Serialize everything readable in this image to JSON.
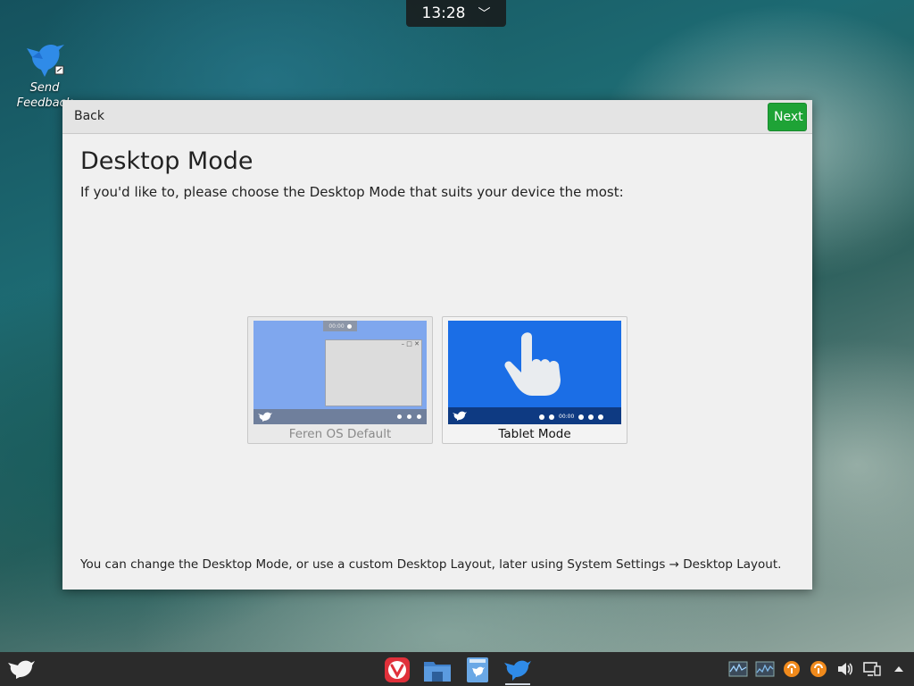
{
  "top_panel": {
    "clock": "13:28",
    "expand_glyph": "﹀"
  },
  "desktop_icons": [
    {
      "label": "Send Feedback",
      "icon": "feedback-bird-icon"
    }
  ],
  "dialog": {
    "back_label": "Back",
    "next_label": "Next",
    "title": "Desktop Mode",
    "subtitle": "If you'd like to, please choose the Desktop Mode that suits your device the most:",
    "footer": "You can change the Desktop Mode, or use a custom Desktop Layout, later using System Settings → Desktop Layout.",
    "modes": [
      {
        "label": "Feren OS Default",
        "preview_clock": "00:00",
        "selected": false
      },
      {
        "label": "Tablet Mode",
        "preview_clock": "00:00",
        "selected": true
      }
    ]
  },
  "taskbar": {
    "start_icon": "feren-bird-icon",
    "apps": [
      {
        "name": "Vivaldi",
        "icon": "vivaldi-icon"
      },
      {
        "name": "Files",
        "icon": "file-manager-icon"
      },
      {
        "name": "Store",
        "icon": "store-icon"
      },
      {
        "name": "Welcome",
        "icon": "feren-bird-icon",
        "active": true
      }
    ],
    "tray": [
      "system-monitor-icon",
      "network-monitor-icon",
      "update-icon",
      "update-icon",
      "volume-icon",
      "display-icon",
      "expand-tray-icon"
    ]
  },
  "colors": {
    "next_button": "#1ea336",
    "tablet_preview": "#1b6ee6",
    "default_preview": "#7fa7ee",
    "taskbar": "#2b2b2b"
  }
}
